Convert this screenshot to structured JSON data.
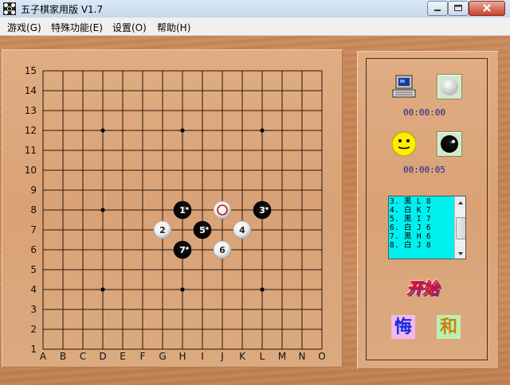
{
  "window": {
    "title": "五子棋家用版 V1.7"
  },
  "menu": {
    "items": [
      {
        "label": "游戏(G)"
      },
      {
        "label": "特殊功能(E)"
      },
      {
        "label": "设置(O)"
      },
      {
        "label": "帮助(H)"
      }
    ]
  },
  "board": {
    "size": 15,
    "col_labels": [
      "A",
      "B",
      "C",
      "D",
      "E",
      "F",
      "G",
      "H",
      "I",
      "J",
      "K",
      "L",
      "M",
      "N",
      "O"
    ],
    "row_labels": [
      "1",
      "2",
      "3",
      "4",
      "5",
      "6",
      "7",
      "8",
      "9",
      "10",
      "11",
      "12",
      "13",
      "14",
      "15"
    ],
    "star_points": [
      "D4",
      "H4",
      "L4",
      "D8",
      "H8",
      "L8",
      "D12",
      "H12",
      "L12"
    ],
    "stones": [
      {
        "move": "1",
        "color": "black",
        "pos": "H8"
      },
      {
        "move": "2",
        "color": "white",
        "pos": "G7"
      },
      {
        "move": "3",
        "color": "black",
        "pos": "L8"
      },
      {
        "move": "4",
        "color": "white",
        "pos": "K7"
      },
      {
        "move": "5",
        "color": "black",
        "pos": "I7"
      },
      {
        "move": "6",
        "color": "white",
        "pos": "J6"
      },
      {
        "move": "7",
        "color": "black",
        "pos": "H6"
      },
      {
        "move": "",
        "color": "white",
        "pos": "J8",
        "last": true
      }
    ]
  },
  "players": {
    "computer": {
      "icon": "computer-icon",
      "stone": "white",
      "time": "00:00:00"
    },
    "human": {
      "icon": "smiley-icon",
      "stone": "black",
      "time": "00:00:05"
    }
  },
  "move_list": [
    "3. 黑 L 8",
    "4. 白 K 7",
    "5. 黑 I 7",
    "6. 白 J 6",
    "7. 黑 H 6",
    "8. 白 J 8"
  ],
  "buttons": {
    "start": "开始",
    "undo": "悔",
    "draw": "和"
  },
  "colors": {
    "movelist_bg": "#00f0f0",
    "start_text": "#e0102a",
    "undo_bg": "#f4b8f0",
    "draw_bg": "#b9f0b0"
  }
}
